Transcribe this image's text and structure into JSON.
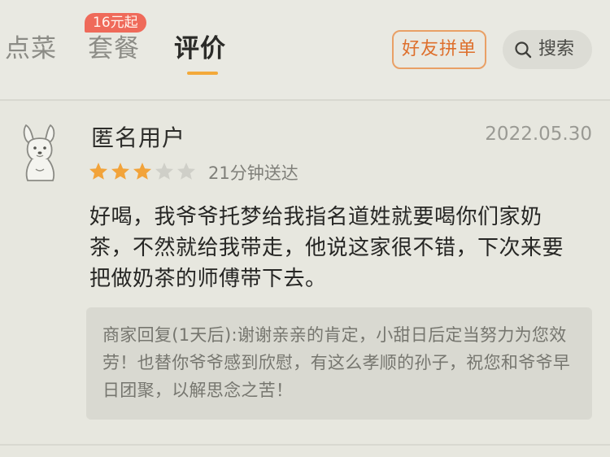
{
  "tabs": {
    "dishes": "点菜",
    "combo": "套餐",
    "review": "评价",
    "combo_badge": "16元起"
  },
  "actions": {
    "group_order": "好友拼单",
    "search": "搜索"
  },
  "review": {
    "user_name": "匿名用户",
    "date": "2022.05.30",
    "rating": 3,
    "max_rating": 5,
    "delivery_time": "21分钟送达",
    "text": "好喝，我爷爷托梦给我指名道姓就要喝你们家奶茶，不然就给我带走，他说这家很不错，下次来要把做奶茶的师傅带下去。",
    "merchant_reply": "商家回复(1天后):谢谢亲亲的肯定，小甜日后定当努力为您效劳！也替你爷爷感到欣慰，有这么孝顺的孙子，祝您和爷爷早日团聚，以解思念之苦！"
  },
  "colors": {
    "accent_orange": "#f3a93a",
    "star_filled": "#f2a33a",
    "star_empty": "#cfcfc8",
    "badge_red": "#ef6a5a",
    "group_btn_orange": "#de6f2c"
  },
  "icons": {
    "search": "magnifier",
    "avatar": "kangaroo-mascot",
    "rating": "star"
  }
}
